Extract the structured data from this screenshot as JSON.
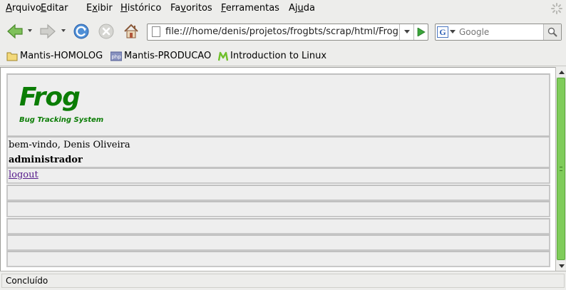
{
  "menu": {
    "items": [
      {
        "accel": "A",
        "rest": "rquivo"
      },
      {
        "accel": "E",
        "rest": "ditar"
      },
      {
        "accel": "E",
        "rest": "xibir",
        "pre": "",
        "u_at": 1
      },
      {
        "accel": "H",
        "rest": "istórico"
      },
      {
        "accel": "F",
        "rest": "avoritos",
        "pre": "Fa",
        "mid": "v"
      },
      {
        "accel": "F",
        "rest": "erramentas"
      },
      {
        "accel": "u",
        "rest": "da",
        "pre": "Aj"
      }
    ],
    "labels": [
      "Arquivo",
      "Editar",
      "Exibir",
      "Histórico",
      "Favoritos",
      "Ferramentas",
      "Ajuda"
    ]
  },
  "navigation": {
    "back_icon": "back-arrow-icon",
    "forward_icon": "forward-arrow-icon",
    "reload_icon": "reload-icon",
    "stop_icon": "stop-icon",
    "home_icon": "home-icon",
    "url": "file:///home/denis/projetos/frogbts/scrap/html/FrogBts.html",
    "search_placeholder": "Google"
  },
  "bookmarks": [
    {
      "icon": "folder-icon",
      "label": "Mantis-HOMOLOG"
    },
    {
      "icon": "php-icon",
      "label": "Mantis-PRODUCAO"
    },
    {
      "icon": "m-icon",
      "label": "Introduction to Linux"
    }
  ],
  "page": {
    "logo_title": "Frog",
    "logo_subtitle": "Bug Tracking System",
    "welcome": "bem-vindo, Denis Oliveira",
    "role": "administrador",
    "logout": "logout",
    "brand_green": "#0b7d05"
  },
  "status": {
    "text": "Concluído"
  }
}
